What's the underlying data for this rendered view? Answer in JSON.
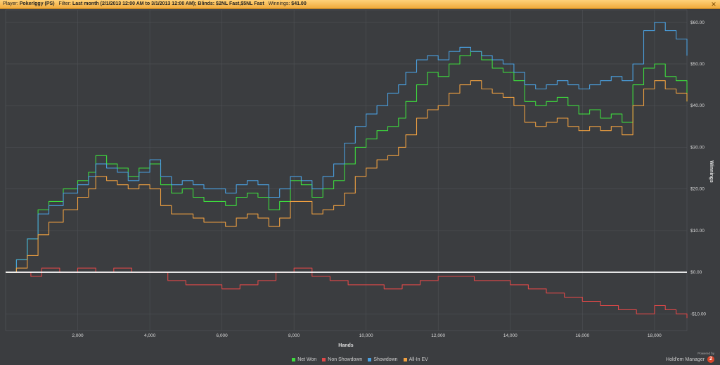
{
  "header": {
    "player_label": "Player:",
    "player_value": "Pokerlggy (PS)",
    "filter_label": "Filter:",
    "filter_value": "Last month (2/1/2013 12:00 AM to 3/1/2013 12:00 AM); Blinds: $2NL Fast,$5NL Fast",
    "winnings_label": "Winnings:",
    "winnings_value": "$41.00",
    "close_icon": "close-icon"
  },
  "branding": {
    "powered": "Powered by",
    "name": "Hold'em Manager",
    "logo": "2"
  },
  "chart_data": {
    "type": "line",
    "title": "",
    "xlabel": "Hands",
    "ylabel": "Winnings",
    "xlim": [
      0,
      18900
    ],
    "ylim": [
      -14,
      63
    ],
    "x_ticks": [
      2000,
      4000,
      6000,
      8000,
      10000,
      12000,
      14000,
      16000,
      18000
    ],
    "x_tick_labels": [
      "2,000",
      "4,000",
      "6,000",
      "8,000",
      "10,000",
      "12,000",
      "14,000",
      "16,000",
      "18,000"
    ],
    "y_ticks": [
      60,
      50,
      40,
      30,
      20,
      10,
      0,
      -10
    ],
    "y_tick_labels": [
      "$60.00",
      "$50.00",
      "$40.00",
      "$30.00",
      "$20.00",
      "$10.00",
      "$0.00",
      "-$10.00"
    ],
    "grid": true,
    "legend_position": "bottom",
    "series": [
      {
        "name": "Net Won",
        "color": "#3ddc3d",
        "x": [
          0,
          300,
          600,
          900,
          1200,
          1600,
          2000,
          2300,
          2500,
          2800,
          3100,
          3400,
          3700,
          4000,
          4300,
          4600,
          4900,
          5200,
          5500,
          5800,
          6100,
          6400,
          6700,
          7000,
          7300,
          7600,
          7900,
          8200,
          8500,
          8800,
          9100,
          9400,
          9700,
          10000,
          10300,
          10600,
          10900,
          11100,
          11400,
          11700,
          12000,
          12300,
          12600,
          12900,
          13200,
          13500,
          13800,
          14100,
          14400,
          14700,
          15000,
          15300,
          15600,
          15900,
          16200,
          16500,
          16800,
          17100,
          17400,
          17700,
          18000,
          18300,
          18600,
          18900
        ],
        "y": [
          0,
          3,
          8,
          15,
          17,
          20,
          22,
          24,
          28,
          26,
          25,
          23,
          25,
          26,
          21,
          19,
          20,
          18,
          17,
          17,
          16,
          18,
          19,
          18,
          15,
          17,
          22,
          21,
          18,
          20,
          22,
          26,
          30,
          32,
          34,
          35,
          37,
          41,
          45,
          48,
          47,
          50,
          52,
          53,
          51,
          49,
          48,
          46,
          41,
          40,
          41,
          42,
          40,
          38,
          39,
          37,
          38,
          36,
          45,
          49,
          50,
          47,
          46,
          41
        ]
      },
      {
        "name": "Non Showdown",
        "color": "#e04848",
        "x": [
          0,
          300,
          700,
          1000,
          1500,
          2000,
          2500,
          3000,
          3500,
          4000,
          4500,
          5000,
          5500,
          6000,
          6500,
          7000,
          7500,
          8000,
          8500,
          9000,
          9500,
          10000,
          10500,
          11000,
          11500,
          12000,
          12500,
          13000,
          13500,
          14000,
          14500,
          15000,
          15500,
          16000,
          16500,
          17000,
          17500,
          18000,
          18300,
          18600,
          18900
        ],
        "y": [
          0,
          0,
          -1,
          1,
          0,
          1,
          0,
          1,
          0,
          0,
          -2,
          -3,
          -3,
          -4,
          -3,
          -2,
          0,
          1,
          -1,
          -2,
          -3,
          -3,
          -4,
          -3,
          -2,
          -1,
          -1,
          -2,
          -2,
          -3,
          -4,
          -5,
          -6,
          -7,
          -8,
          -9,
          -10,
          -8,
          -9,
          -10,
          -11
        ]
      },
      {
        "name": "Showdown",
        "color": "#4aa0e0",
        "x": [
          0,
          300,
          600,
          900,
          1200,
          1600,
          2000,
          2300,
          2500,
          2800,
          3100,
          3400,
          3700,
          4000,
          4300,
          4600,
          4900,
          5200,
          5500,
          5800,
          6100,
          6400,
          6700,
          7000,
          7300,
          7600,
          7900,
          8200,
          8500,
          8800,
          9100,
          9400,
          9700,
          10000,
          10300,
          10600,
          10900,
          11100,
          11400,
          11700,
          12000,
          12300,
          12600,
          12900,
          13200,
          13500,
          13800,
          14100,
          14400,
          14700,
          15000,
          15300,
          15600,
          15900,
          16200,
          16500,
          16800,
          17100,
          17400,
          17700,
          18000,
          18300,
          18600,
          18900
        ],
        "y": [
          0,
          3,
          8,
          14,
          16,
          19,
          21,
          23,
          26,
          25,
          24,
          22,
          24,
          27,
          23,
          21,
          22,
          21,
          20,
          20,
          19,
          21,
          22,
          21,
          18,
          20,
          23,
          22,
          20,
          23,
          26,
          31,
          35,
          38,
          40,
          43,
          45,
          48,
          51,
          52,
          51,
          53,
          54,
          53,
          52,
          51,
          50,
          48,
          45,
          44,
          45,
          46,
          45,
          44,
          45,
          46,
          47,
          46,
          50,
          58,
          60,
          58,
          56,
          52
        ]
      },
      {
        "name": "All-In EV",
        "color": "#f0a040",
        "x": [
          0,
          300,
          600,
          900,
          1200,
          1600,
          2000,
          2300,
          2500,
          2800,
          3100,
          3400,
          3700,
          4000,
          4300,
          4600,
          4900,
          5200,
          5500,
          5800,
          6100,
          6400,
          6700,
          7000,
          7300,
          7600,
          7900,
          8200,
          8500,
          8800,
          9100,
          9400,
          9700,
          10000,
          10300,
          10600,
          10900,
          11100,
          11400,
          11700,
          12000,
          12300,
          12600,
          12900,
          13200,
          13500,
          13800,
          14100,
          14400,
          14700,
          15000,
          15300,
          15600,
          15900,
          16200,
          16500,
          16800,
          17100,
          17400,
          17700,
          18000,
          18300,
          18600,
          18900
        ],
        "y": [
          0,
          1,
          4,
          9,
          12,
          15,
          18,
          20,
          23,
          22,
          21,
          20,
          21,
          20,
          16,
          14,
          14,
          13,
          12,
          12,
          11,
          13,
          14,
          13,
          11,
          13,
          17,
          17,
          14,
          15,
          16,
          19,
          23,
          25,
          27,
          28,
          30,
          33,
          37,
          39,
          40,
          43,
          45,
          46,
          44,
          43,
          42,
          40,
          36,
          35,
          36,
          37,
          35,
          34,
          35,
          34,
          35,
          33,
          40,
          44,
          46,
          44,
          43,
          41
        ]
      }
    ]
  }
}
